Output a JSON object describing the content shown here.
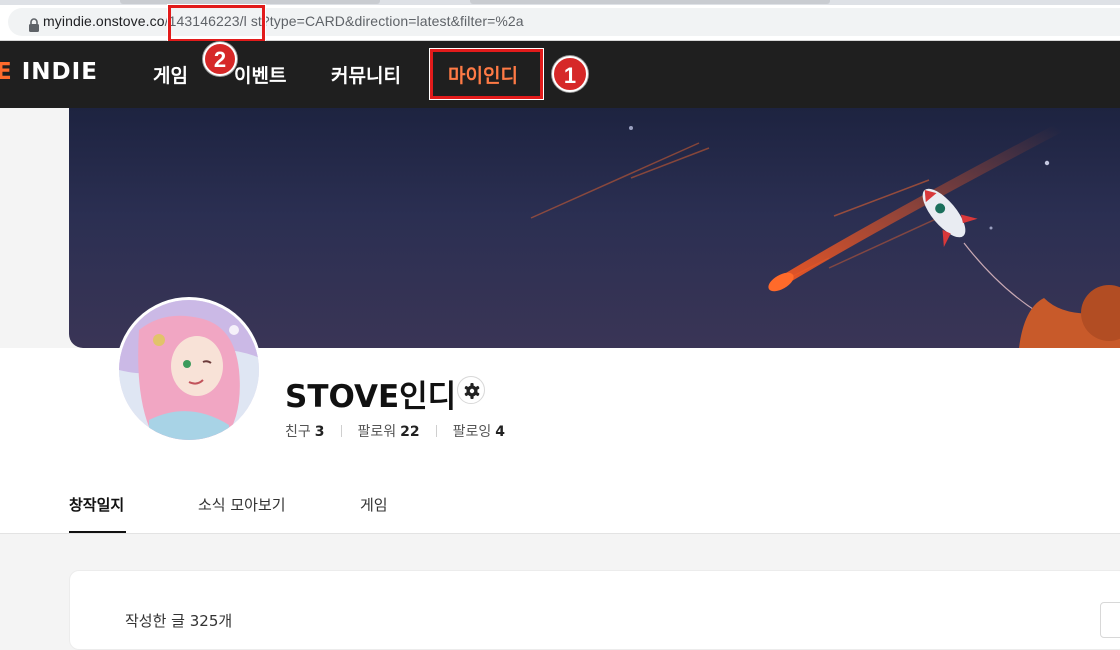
{
  "browser": {
    "url_host": "myindie.onstove.co",
    "url_id": "/143146223/",
    "url_rest": "l   st?type=CARD&direction=latest&filter=%2a"
  },
  "site_nav": {
    "logo_mark": "E",
    "logo_text": "INDIE",
    "items": [
      {
        "label": "게임"
      },
      {
        "label": "이벤트"
      },
      {
        "label": "커뮤니티"
      },
      {
        "label": "마이인디"
      }
    ]
  },
  "annotations": {
    "badge_1": "1",
    "badge_2": "2"
  },
  "profile": {
    "name": "STOVE인디",
    "stats": [
      {
        "label": "친구",
        "value": "3"
      },
      {
        "label": "팔로워",
        "value": "22"
      },
      {
        "label": "팔로잉",
        "value": "4"
      }
    ]
  },
  "tabs": [
    {
      "label": "창작일지"
    },
    {
      "label": "소식 모아보기"
    },
    {
      "label": "게임"
    }
  ],
  "content": {
    "post_count": "작성한 글 325개"
  },
  "colors": {
    "nav_bg": "#1f1f1f",
    "accent": "#ff7a45",
    "highlight": "#e21b1b"
  }
}
